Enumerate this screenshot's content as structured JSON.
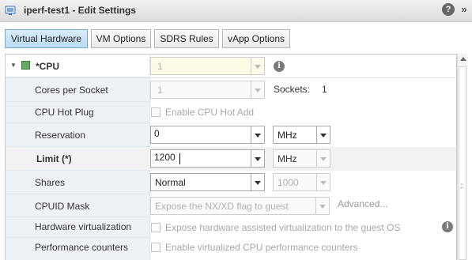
{
  "window": {
    "title": "iperf-test1 - Edit Settings",
    "help_label": "?",
    "expand_label": "»"
  },
  "tabs": [
    {
      "label": "Virtual Hardware",
      "active": true
    },
    {
      "label": "VM Options"
    },
    {
      "label": "SDRS Rules"
    },
    {
      "label": "vApp Options"
    }
  ],
  "cpu": {
    "label": "*CPU",
    "count": "1",
    "info_label": "i"
  },
  "cores_per_socket": {
    "label": "Cores per Socket",
    "value": "1",
    "sockets_label": "Sockets:",
    "sockets_value": "1"
  },
  "cpu_hot_plug": {
    "label": "CPU Hot Plug",
    "option": "Enable CPU Hot Add"
  },
  "reservation": {
    "label": "Reservation",
    "value": "0",
    "unit": "MHz"
  },
  "limit": {
    "label": "Limit (*)",
    "value": "1200",
    "unit": "MHz"
  },
  "shares": {
    "label": "Shares",
    "level": "Normal",
    "value": "1000"
  },
  "cpuid_mask": {
    "label": "CPUID Mask",
    "value": "Expose the NX/XD flag to guest",
    "advanced_label": "Advanced..."
  },
  "hardware_virtualization": {
    "label": "Hardware virtualization",
    "option": "Expose hardware assisted virtualization to the guest OS",
    "info_label": "i"
  },
  "performance_counters": {
    "label": "Performance counters",
    "option": "Enable virtualized CPU performance counters"
  },
  "scrollbar": {
    "grip_label": "::"
  }
}
